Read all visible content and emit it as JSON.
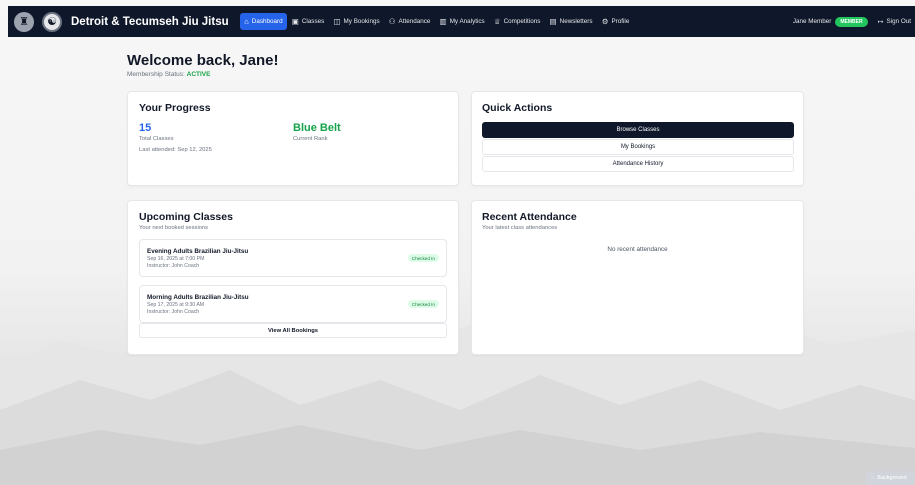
{
  "nav": {
    "brand": "Detroit & Tecumseh Jiu Jitsu",
    "links": [
      {
        "label": "Dashboard",
        "icon": "home-icon",
        "glyph": "⌂"
      },
      {
        "label": "Classes",
        "icon": "calendar-icon",
        "glyph": "▣"
      },
      {
        "label": "My Bookings",
        "icon": "book-icon",
        "glyph": "◫"
      },
      {
        "label": "Attendance",
        "icon": "user-check-icon",
        "glyph": "⚇"
      },
      {
        "label": "My Analytics",
        "icon": "bar-chart-icon",
        "glyph": "▥"
      },
      {
        "label": "Competitions",
        "icon": "trophy-icon",
        "glyph": "♕"
      },
      {
        "label": "Newsletters",
        "icon": "newspaper-icon",
        "glyph": "▤"
      },
      {
        "label": "Profile",
        "icon": "settings-icon",
        "glyph": "⚙"
      }
    ],
    "active_index": 0,
    "user_name": "Jane Member",
    "member_badge": "MEMBER",
    "sign_out": "Sign Out"
  },
  "welcome": {
    "title": "Welcome back, Jane!",
    "status_label": "Membership Status:",
    "status_value": "ACTIVE"
  },
  "progress": {
    "title": "Your Progress",
    "total_classes": "15",
    "total_classes_label": "Total Classes",
    "rank": "Blue Belt",
    "rank_label": "Current Rank",
    "last_attended": "Last attended: Sep 12, 2025"
  },
  "quick_actions": {
    "title": "Quick Actions",
    "browse": "Browse Classes",
    "bookings": "My Bookings",
    "history": "Attendance History"
  },
  "upcoming": {
    "title": "Upcoming Classes",
    "subtitle": "Your next booked sessions",
    "classes": [
      {
        "name": "Evening Adults Brazilian Jiu-Jitsu",
        "when": "Sep 16, 2025 at 7:00 PM",
        "instructor": "Instructor: John Coach",
        "status": "Checked In"
      },
      {
        "name": "Morning Adults Brazilian Jiu-Jitsu",
        "when": "Sep 17, 2025 at 9:30 AM",
        "instructor": "Instructor: John Coach",
        "status": "Checked In"
      }
    ],
    "view_all": "View All Bookings"
  },
  "recent": {
    "title": "Recent Attendance",
    "subtitle": "Your latest class attendances",
    "empty": "No recent attendance"
  },
  "background_button": "Background",
  "colors": {
    "nav_bg": "#0f172a",
    "accent": "#2563eb",
    "success": "#16a34a"
  }
}
